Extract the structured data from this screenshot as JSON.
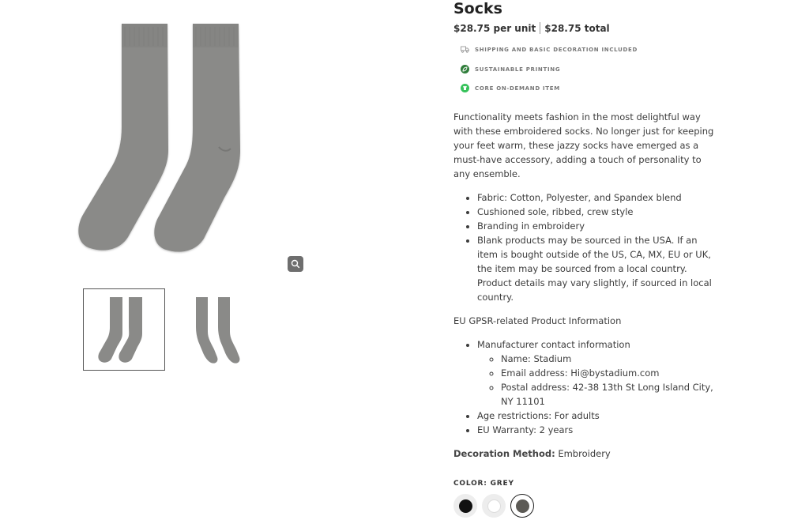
{
  "product": {
    "title": "Socks",
    "price_unit": "$28.75 per unit",
    "price_total": "$28.75 total"
  },
  "features": [
    {
      "icon": "truck-icon",
      "label": "SHIPPING AND BASIC DECORATION INCLUDED"
    },
    {
      "icon": "leaf-icon",
      "label": "SUSTAINABLE PRINTING"
    },
    {
      "icon": "shirt-icon",
      "label": "CORE ON-DEMAND ITEM"
    }
  ],
  "description": "Functionality meets fashion in the most delightful way with these embroidered socks. No longer just for keeping your feet warm, these jazzy socks have emerged as a must-have accessory, adding a touch of personality to any ensemble.",
  "specs": [
    "Fabric: Cotton, Polyester, and Spandex blend",
    "Cushioned sole, ribbed, crew style",
    "Branding in embroidery",
    "Blank products may be sourced in the USA. If an item is bought outside of the US, CA, MX, EU or UK, the item may be sourced from a local country. Product details may vary slightly, if sourced in local country."
  ],
  "gpsr": {
    "title": "EU GPSR-related Product Information",
    "manufacturer_label": "Manufacturer contact information",
    "name": "Name: Stadium",
    "email": "Email address: Hi@bystadium.com",
    "postal": "Postal address: 42-38 13th St Long Island City, NY 11101",
    "age": "Age restrictions: For adults",
    "warranty": "EU Warranty: 2 years"
  },
  "decoration": {
    "label": "Decoration Method:",
    "value": " Embroidery"
  },
  "color": {
    "label": "COLOR: GREY",
    "swatches": [
      {
        "name": "black",
        "hex": "#111111"
      },
      {
        "name": "white",
        "hex": "#ffffff"
      },
      {
        "name": "grey",
        "hex": "#5c5a55"
      }
    ]
  },
  "colors": {
    "sock": "#8a8a88",
    "sock_dark": "#7a7a78",
    "leaf_green": "#2f7d3a",
    "shirt_green": "#36c25a"
  }
}
